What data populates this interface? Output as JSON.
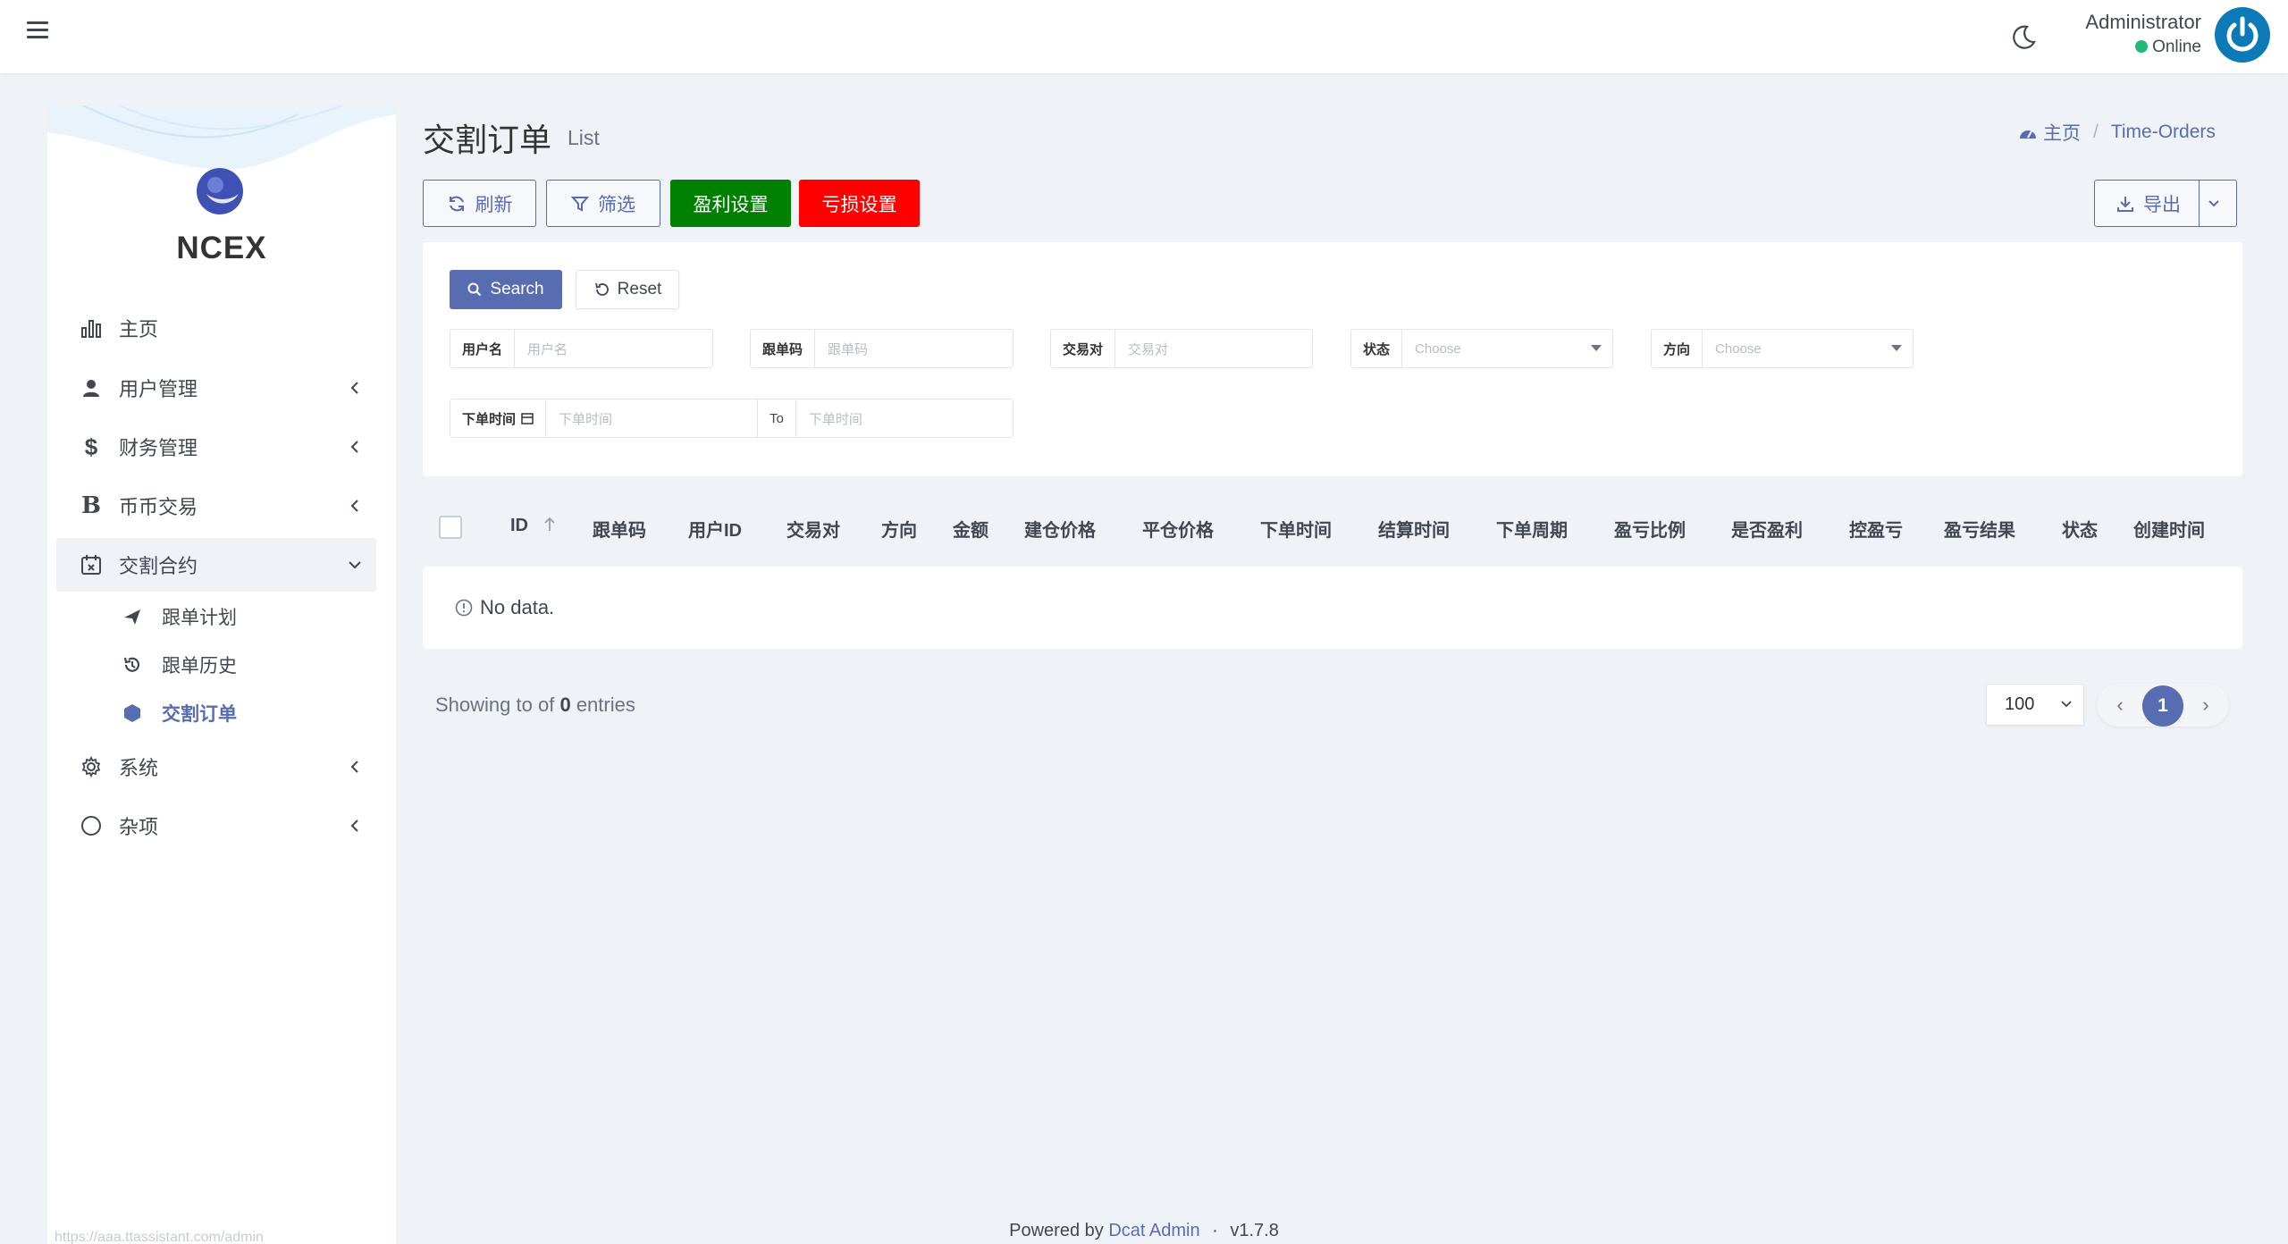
{
  "header": {
    "user_name": "Administrator",
    "user_status": "Online"
  },
  "sidebar": {
    "brand": "NCEX",
    "items": [
      {
        "label": "主页",
        "icon": "bar-chart-icon"
      },
      {
        "label": "用户管理",
        "icon": "user-icon"
      },
      {
        "label": "财务管理",
        "icon": "dollar-icon"
      },
      {
        "label": "币币交易",
        "icon": "bitcoin-icon"
      },
      {
        "label": "交割合约",
        "icon": "calendar-icon"
      },
      {
        "label": "系统",
        "icon": "gear-icon"
      },
      {
        "label": "杂项",
        "icon": "circle-icon"
      }
    ],
    "sub_items": [
      {
        "label": "跟单计划",
        "icon": "plane-icon"
      },
      {
        "label": "跟单历史",
        "icon": "history-icon"
      },
      {
        "label": "交割订单",
        "icon": "hexagon-icon"
      }
    ],
    "url_hint": "https://aaa.ttassistant.com/admin"
  },
  "page": {
    "title": "交割订单",
    "subtitle": "List",
    "breadcrumb": {
      "home": "主页",
      "current": "Time-Orders"
    }
  },
  "toolbar": {
    "refresh": "刷新",
    "filter": "筛选",
    "profit_settings": "盈利设置",
    "loss_settings": "亏损设置",
    "export": "导出"
  },
  "filters": {
    "search_label": "Search",
    "reset_label": "Reset",
    "username": {
      "label": "用户名",
      "placeholder": "用户名"
    },
    "follow_code": {
      "label": "跟单码",
      "placeholder": "跟单码"
    },
    "pair": {
      "label": "交易对",
      "placeholder": "交易对"
    },
    "status": {
      "label": "状态",
      "value": "Choose"
    },
    "direction": {
      "label": "方向",
      "value": "Choose"
    },
    "order_time": {
      "label": "下单时间",
      "placeholder_from": "下单时间",
      "to_label": "To",
      "placeholder_to": "下单时间"
    }
  },
  "table": {
    "columns": [
      "ID",
      "跟单码",
      "用户ID",
      "交易对",
      "方向",
      "金额",
      "建仓价格",
      "平仓价格",
      "下单时间",
      "结算时间",
      "下单周期",
      "盈亏比例",
      "是否盈利",
      "控盈亏",
      "盈亏结果",
      "状态",
      "创建时间"
    ],
    "empty_text": "No data."
  },
  "pagination": {
    "entries_prefix": "Showing to of",
    "entries_total": "0",
    "entries_suffix": "entries",
    "per_page": "100",
    "current_page": "1"
  },
  "footer": {
    "powered_by": "Powered by",
    "brand_link": "Dcat Admin",
    "separator": "·",
    "version": "v1.7.8"
  },
  "colors": {
    "primary": "#586cb1",
    "profit_button": "#008000",
    "loss_button": "#ff0000",
    "online": "#21b978",
    "avatar": "#0d7ab8"
  }
}
